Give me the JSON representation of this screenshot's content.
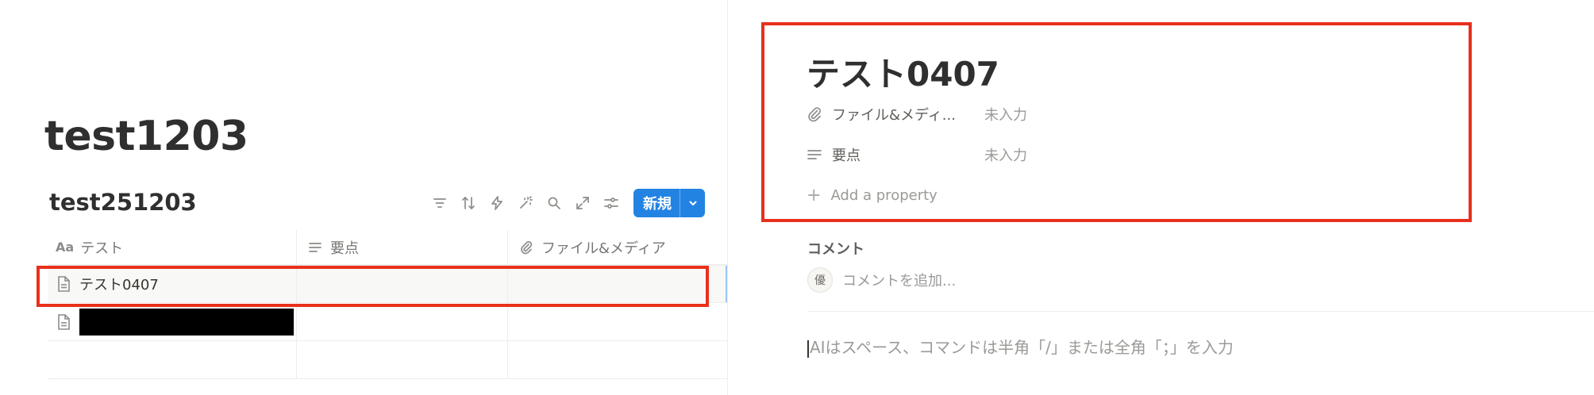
{
  "left": {
    "page_title": "test1203",
    "database_title": "test251203",
    "toolbar": {
      "icons": [
        "filter-icon",
        "sort-icon",
        "automation-bolt-icon",
        "ai-sparkle-icon",
        "search-icon",
        "expand-icon",
        "settings-sliders-icon"
      ],
      "new_label": "新規"
    },
    "table": {
      "columns": [
        {
          "icon": "Aa",
          "label": "テスト"
        },
        {
          "icon": "text-lines-icon",
          "label": "要点"
        },
        {
          "icon": "paperclip-icon",
          "label": "ファイル&メディア"
        }
      ],
      "rows": [
        {
          "title": "テスト0407"
        },
        {
          "title": "",
          "redacted": true
        }
      ]
    }
  },
  "right": {
    "item_title": "テスト0407",
    "properties": [
      {
        "icon": "paperclip-icon",
        "name": "ファイル&メディ...",
        "value": "未入力"
      },
      {
        "icon": "text-lines-icon",
        "name": "要点",
        "value": "未入力"
      }
    ],
    "add_property_label": "Add a property",
    "comments_label": "コメント",
    "avatar_initial": "優",
    "comment_placeholder": "コメントを追加...",
    "body_placeholder": "AIはスペース、コマンドは半角「/」または全角「；」を入力"
  },
  "colors": {
    "accent": "#2383e2",
    "highlight_box": "#e8301c"
  }
}
